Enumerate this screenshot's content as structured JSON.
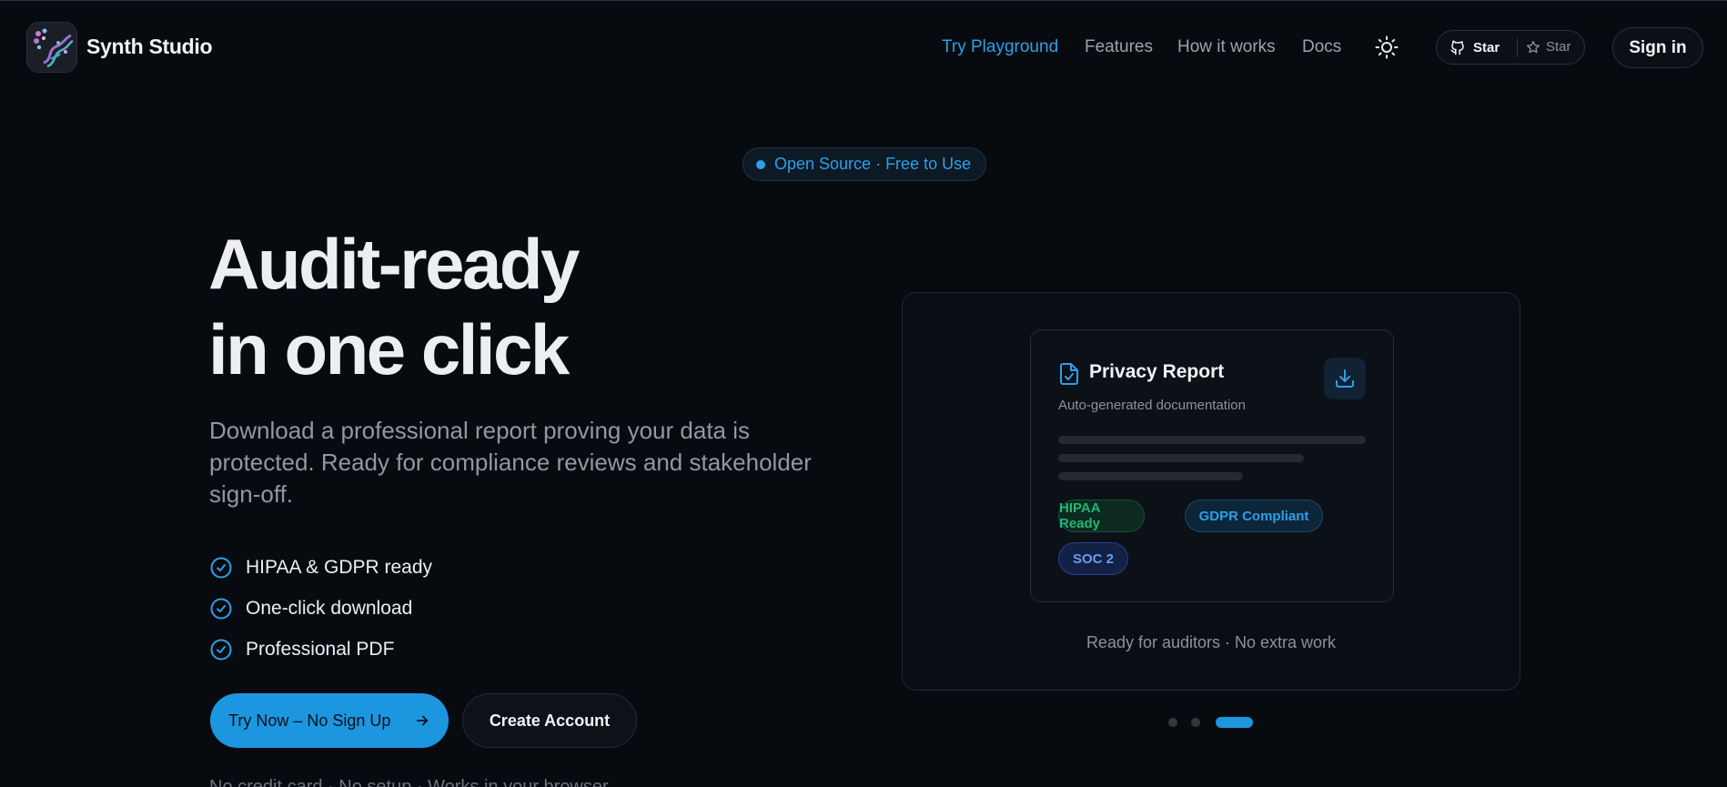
{
  "nav": {
    "brand": "Synth Studio",
    "links": [
      {
        "label": "Try Playground",
        "active": true
      },
      {
        "label": "Features",
        "active": false
      },
      {
        "label": "How it works",
        "active": false
      },
      {
        "label": "Docs",
        "active": false
      }
    ],
    "github": {
      "star_label": "Star",
      "count_label": "Star"
    },
    "sign_in": "Sign in"
  },
  "badge": {
    "text": "Open Source · Free to Use"
  },
  "hero": {
    "title_line1": "Audit-ready",
    "title_line2": "in one click",
    "subtitle": "Download a professional report proving your data is protected. Ready for compliance reviews and stakeholder sign-off.",
    "features": [
      "HIPAA & GDPR ready",
      "One-click download",
      "Professional PDF"
    ],
    "primary_button": "Try Now – No Sign Up",
    "secondary_button": "Create Account",
    "fineprint": "No credit card · No setup · Works in your browser"
  },
  "preview": {
    "card_title": "Privacy Report",
    "card_subtitle": "Auto-generated documentation",
    "chips": [
      "HIPAA Ready",
      "GDPR Compliant",
      "SOC 2"
    ],
    "caption": "Ready for auditors · No extra work",
    "slides": {
      "count": 3,
      "active": 3
    }
  },
  "colors": {
    "accent": "#2e9fe6",
    "background": "#070b10",
    "chip_green": "#22b673",
    "chip_indigo": "#6b9cf0"
  },
  "icons": [
    "logo-icon",
    "sun-icon",
    "github-icon",
    "star-icon",
    "check-circle-icon",
    "arrow-right-icon",
    "document-check-icon",
    "download-icon"
  ]
}
